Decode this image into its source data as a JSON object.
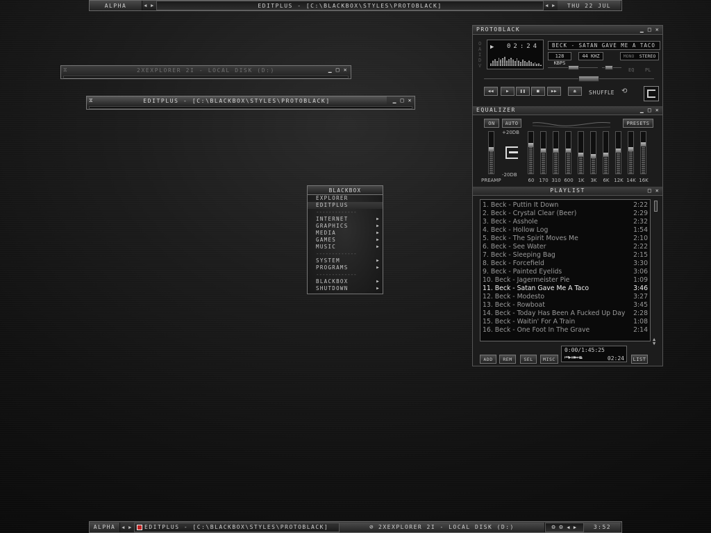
{
  "top_bar": {
    "workspace": "ALPHA",
    "title": "EDITPLUS - [C:\\BLACKBOX\\STYLES\\PROTOBLACK]",
    "date": "THU 22 JUL"
  },
  "explorer_window": {
    "title": "2XEXPLORER 2I - LOCAL DISK (D:)"
  },
  "editplus_window": {
    "title": "EDITPLUS - [C:\\BLACKBOX\\STYLES\\PROTOBLACK]"
  },
  "menu": {
    "title": "BLACKBOX",
    "items": [
      {
        "label": "EXPLORER",
        "submenu": false
      },
      {
        "label": "EDITPLUS",
        "submenu": false
      },
      {
        "label": "-------------",
        "separator": true
      },
      {
        "label": "INTERNET",
        "submenu": true
      },
      {
        "label": "GRAPHICS",
        "submenu": true
      },
      {
        "label": "MEDIA",
        "submenu": true
      },
      {
        "label": "GAMES",
        "submenu": true
      },
      {
        "label": "MUSIC",
        "submenu": true
      },
      {
        "label": "-------------",
        "separator": true
      },
      {
        "label": "SYSTEM",
        "submenu": true
      },
      {
        "label": "PROGRAMS",
        "submenu": true
      },
      {
        "label": "-------------",
        "separator": true
      },
      {
        "label": "BLACKBOX",
        "submenu": true
      },
      {
        "label": "SHUTDOWN",
        "submenu": true
      }
    ]
  },
  "player": {
    "title": "PROTOBLACK",
    "side_letters": "OAIDV",
    "song": "BECK - SATAN GAVE ME A TACO (3",
    "time": "02:24",
    "kbps": "128 KBPS",
    "khz": "44 KHZ",
    "mono": "MONO",
    "stereo": "STEREO",
    "eq_label": "EQ",
    "pl_label": "PL",
    "shuffle": "SHUFFLE",
    "transport": [
      "prev-icon",
      "play-icon",
      "pause-icon",
      "stop-icon",
      "next-icon",
      "eject-icon"
    ]
  },
  "equalizer": {
    "title": "EQUALIZER",
    "on": "ON",
    "auto": "AUTO",
    "presets": "PRESETS",
    "plus": "+20DB",
    "minus": "-20DB",
    "preamp": "PREAMP",
    "preamp_level": 0.6,
    "bands": [
      {
        "label": "60",
        "level": 0.7
      },
      {
        "label": "170",
        "level": 0.55
      },
      {
        "label": "310",
        "level": 0.55
      },
      {
        "label": "600",
        "level": 0.55
      },
      {
        "label": "1K",
        "level": 0.45
      },
      {
        "label": "3K",
        "level": 0.4
      },
      {
        "label": "6K",
        "level": 0.45
      },
      {
        "label": "12K",
        "level": 0.55
      },
      {
        "label": "14K",
        "level": 0.6
      },
      {
        "label": "16K",
        "level": 0.72
      }
    ]
  },
  "playlist": {
    "title": "PLAYLIST",
    "tracks": [
      {
        "name": "1. Beck - Puttin It Down",
        "time": "2:22"
      },
      {
        "name": "2. Beck - Crystal Clear (Beer)",
        "time": "2:29"
      },
      {
        "name": "3. Beck - Asshole",
        "time": "2:32"
      },
      {
        "name": "4. Beck - Hollow Log",
        "time": "1:54"
      },
      {
        "name": "5. Beck - The Spirit Moves Me",
        "time": "2:10"
      },
      {
        "name": "6. Beck - See Water",
        "time": "2:22"
      },
      {
        "name": "7. Beck - Sleeping Bag",
        "time": "2:15"
      },
      {
        "name": "8. Beck - Forcefield",
        "time": "3:30"
      },
      {
        "name": "9. Beck - Painted Eyelids",
        "time": "3:06"
      },
      {
        "name": "10. Beck - Jagermeister Pie",
        "time": "1:09"
      },
      {
        "name": "11. Beck - Satan Gave Me A Taco",
        "time": "3:46",
        "current": true
      },
      {
        "name": "12. Beck - Modesto",
        "time": "3:27"
      },
      {
        "name": "13. Beck - Rowboat",
        "time": "3:45"
      },
      {
        "name": "14. Beck - Today Has Been A Fucked Up Day",
        "time": "2:28"
      },
      {
        "name": "15. Beck - Waitin' For A Train",
        "time": "1:08"
      },
      {
        "name": "16. Beck - One Foot In The Grave",
        "time": "2:14"
      }
    ],
    "total": "0:00/1:45:25",
    "mini_time": "02:24",
    "buttons": [
      "ADD",
      "REM",
      "SEL",
      "MISC"
    ],
    "list_button": "LIST"
  },
  "bottom_bar": {
    "workspace": "ALPHA",
    "task1": "EDITPLUS - [C:\\BLACKBOX\\STYLES\\PROTOBLACK]",
    "task2": "2XEXPLORER 2I - LOCAL DISK (D:)",
    "clock": "3:52"
  }
}
